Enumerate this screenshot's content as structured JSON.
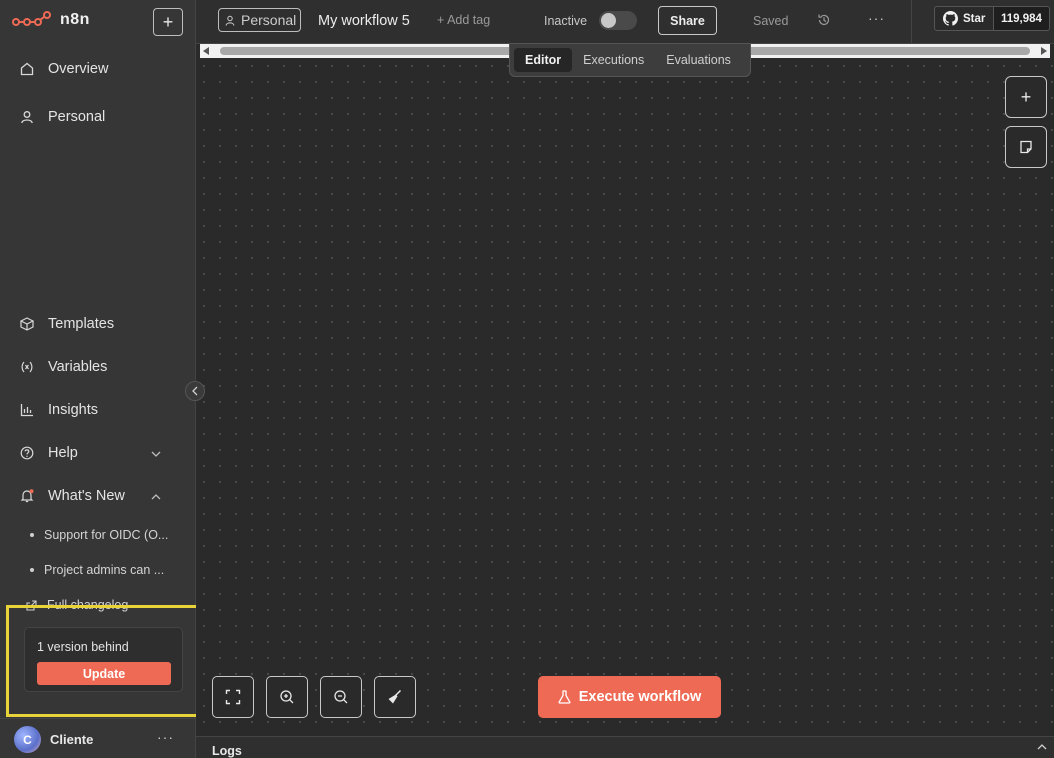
{
  "sidebar": {
    "logo_text": "n8n",
    "new_button": "+",
    "nav_top": [
      {
        "label": "Overview",
        "icon": "home-icon"
      },
      {
        "label": "Personal",
        "icon": "user-icon"
      }
    ],
    "nav_bottom": [
      {
        "label": "Templates",
        "icon": "box-icon"
      },
      {
        "label": "Variables",
        "icon": "variables-icon"
      },
      {
        "label": "Insights",
        "icon": "chart-icon"
      },
      {
        "label": "Help",
        "icon": "help-icon"
      },
      {
        "label": "What's New",
        "icon": "bell-icon"
      }
    ],
    "news": [
      "Support for OIDC (O...",
      "Project admins can ..."
    ],
    "changelog": "Full changelog",
    "update_box": {
      "text": "1 version behind",
      "button": "Update"
    },
    "user": {
      "initial": "C",
      "name": "Cliente",
      "more": "···"
    }
  },
  "header": {
    "project_chip": "Personal",
    "workflow_name": "My workflow 5",
    "add_tag": "+ Add tag",
    "status_label": "Inactive",
    "share": "Share",
    "saved": "Saved",
    "more": "···",
    "github": {
      "star": "Star",
      "count": "119,984"
    }
  },
  "tabs": [
    {
      "label": "Editor",
      "active": true
    },
    {
      "label": "Executions",
      "active": false
    },
    {
      "label": "Evaluations",
      "active": false
    }
  ],
  "canvas": {
    "execute_button": "Execute workflow",
    "side_buttons": [
      "+"
    ]
  },
  "logs": {
    "label": "Logs"
  },
  "colors": {
    "accent": "#ef6a55",
    "highlight": "#e8d33a"
  }
}
